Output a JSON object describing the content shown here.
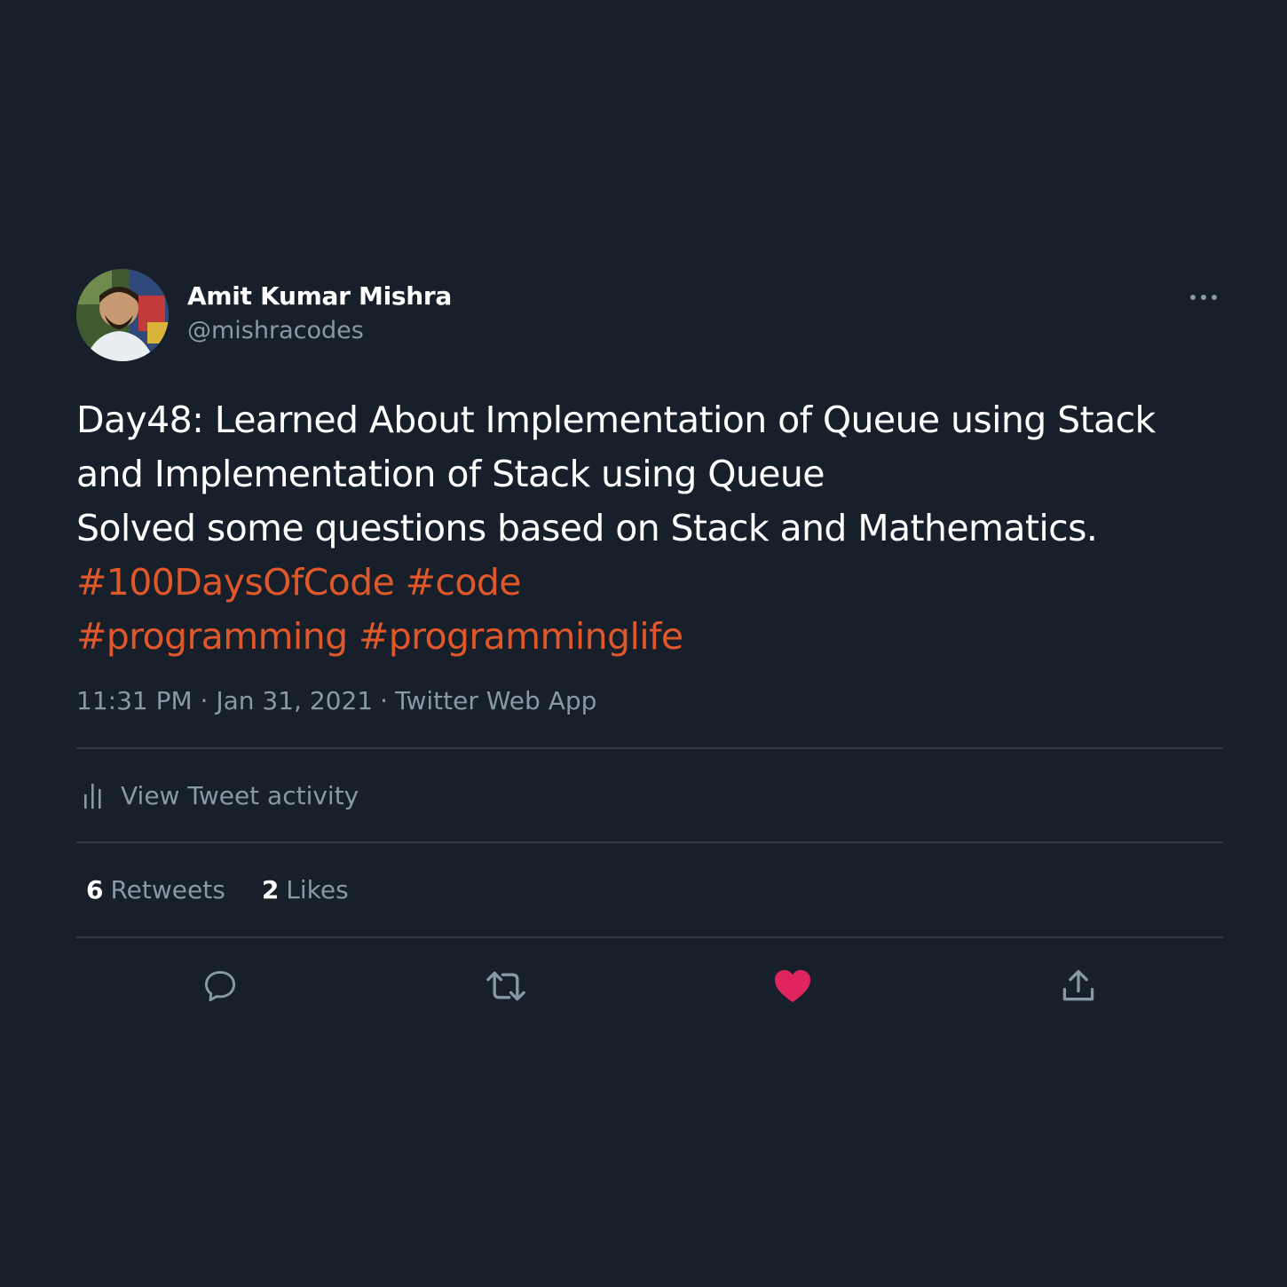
{
  "author": {
    "display_name": "Amit Kumar Mishra",
    "handle": "@mishracodes"
  },
  "tweet": {
    "lines": [
      "Day48: Learned About Implementation of Queue using Stack",
      "and Implementation of Stack using Queue",
      "Solved some questions based on Stack and Mathematics."
    ],
    "hashtags_line1": [
      "#100DaysOfCode",
      "#code"
    ],
    "hashtags_line2": [
      "#programming",
      "#programminglife"
    ],
    "time": "11:31 PM",
    "date": "Jan 31, 2021",
    "separator": "·",
    "source": "Twitter Web App"
  },
  "activity": {
    "label": "View Tweet activity",
    "icon": "bar-chart-icon"
  },
  "stats": {
    "retweets_count": "6",
    "retweets_label": "Retweets",
    "likes_count": "2",
    "likes_label": "Likes"
  },
  "actions": {
    "reply_icon": "reply-icon",
    "retweet_icon": "retweet-icon",
    "like_icon": "heart-icon",
    "share_icon": "share-icon"
  },
  "colors": {
    "background": "#161f2a",
    "text": "#ffffff",
    "muted": "#8899a6",
    "hashtag": "#e0582a",
    "like": "#e0245e",
    "divider": "#2f3a46"
  }
}
